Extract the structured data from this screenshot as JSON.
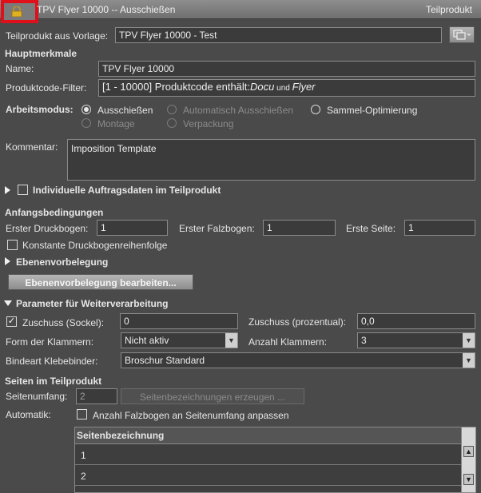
{
  "window": {
    "title": "TPV Flyer 10000 -- Ausschießen",
    "right_label": "Teilprodukt"
  },
  "template": {
    "label": "Teilprodukt aus Vorlage:",
    "value": "TPV Flyer 10000 - Test"
  },
  "hauptmerkmale": {
    "heading": "Hauptmerkmale",
    "name_label": "Name:",
    "name_value": "TPV Flyer 10000",
    "filter_label": "Produktcode-Filter:",
    "filter_prefix": "[1 - 10000] Produktcode enthält:",
    "filter_term1": "Docu",
    "filter_and": " und ",
    "filter_term2": "Flyer"
  },
  "arbeitsmodus": {
    "label": "Arbeitsmodus:",
    "options": [
      {
        "label": "Ausschießen",
        "selected": true,
        "enabled": true
      },
      {
        "label": "Automatisch Ausschießen",
        "selected": false,
        "enabled": false
      },
      {
        "label": "Sammel-Optimierung",
        "selected": false,
        "enabled": true
      },
      {
        "label": "Montage",
        "selected": false,
        "enabled": false
      },
      {
        "label": "Verpackung",
        "selected": false,
        "enabled": false
      }
    ]
  },
  "kommentar": {
    "label": "Kommentar:",
    "value": "Imposition Template"
  },
  "auftragsdaten": {
    "label": "Individuelle Auftragsdaten im Teilprodukt",
    "checked": false
  },
  "anfangsbedingungen": {
    "heading": "Anfangsbedingungen",
    "druckbogen_label": "Erster Druckbogen:",
    "druckbogen_value": "1",
    "falzbogen_label": "Erster Falzbogen:",
    "falzbogen_value": "1",
    "seite_label": "Erste Seite:",
    "seite_value": "1",
    "konstant_label": "Konstante Druckbogenreihenfolge",
    "konstant_checked": false
  },
  "ebenen": {
    "heading": "Ebenenvorbelegung",
    "button": "Ebenenvorbelegung bearbeiten..."
  },
  "weiterverarbeitung": {
    "heading": "Parameter für Weiterverarbeitung",
    "zuschuss_sockel_label": "Zuschuss (Sockel):",
    "zuschuss_sockel_checked": true,
    "zuschuss_sockel_value": "0",
    "zuschuss_proz_label": "Zuschuss (prozentual):",
    "zuschuss_proz_value": "0,0",
    "klammern_form_label": "Form der Klammern:",
    "klammern_form_value": "Nicht aktiv",
    "klammern_anzahl_label": "Anzahl Klammern:",
    "klammern_anzahl_value": "3",
    "bindeart_label": "Bindeart Klebebinder:",
    "bindeart_value": "Broschur Standard"
  },
  "seiten": {
    "heading": "Seiten im Teilprodukt",
    "umfang_label": "Seitenumfang:",
    "umfang_value": "2",
    "erzeugen_button": "Seitenbezeichnungen erzeugen ...",
    "automatik_label": "Automatik:",
    "anpassen_label": "Anzahl Falzbogen an Seitenumfang anpassen",
    "anpassen_checked": false,
    "table_header": "Seitenbezeichnung",
    "rows": [
      "1",
      "2"
    ]
  },
  "icons": {
    "lock": "lock-icon",
    "window_copy": "copy-window-icon",
    "dropdown": "chevron-down-icon"
  },
  "colors": {
    "background": "#4a4a4a",
    "highlight_border": "#e0101a",
    "lock": "#e0b020"
  }
}
